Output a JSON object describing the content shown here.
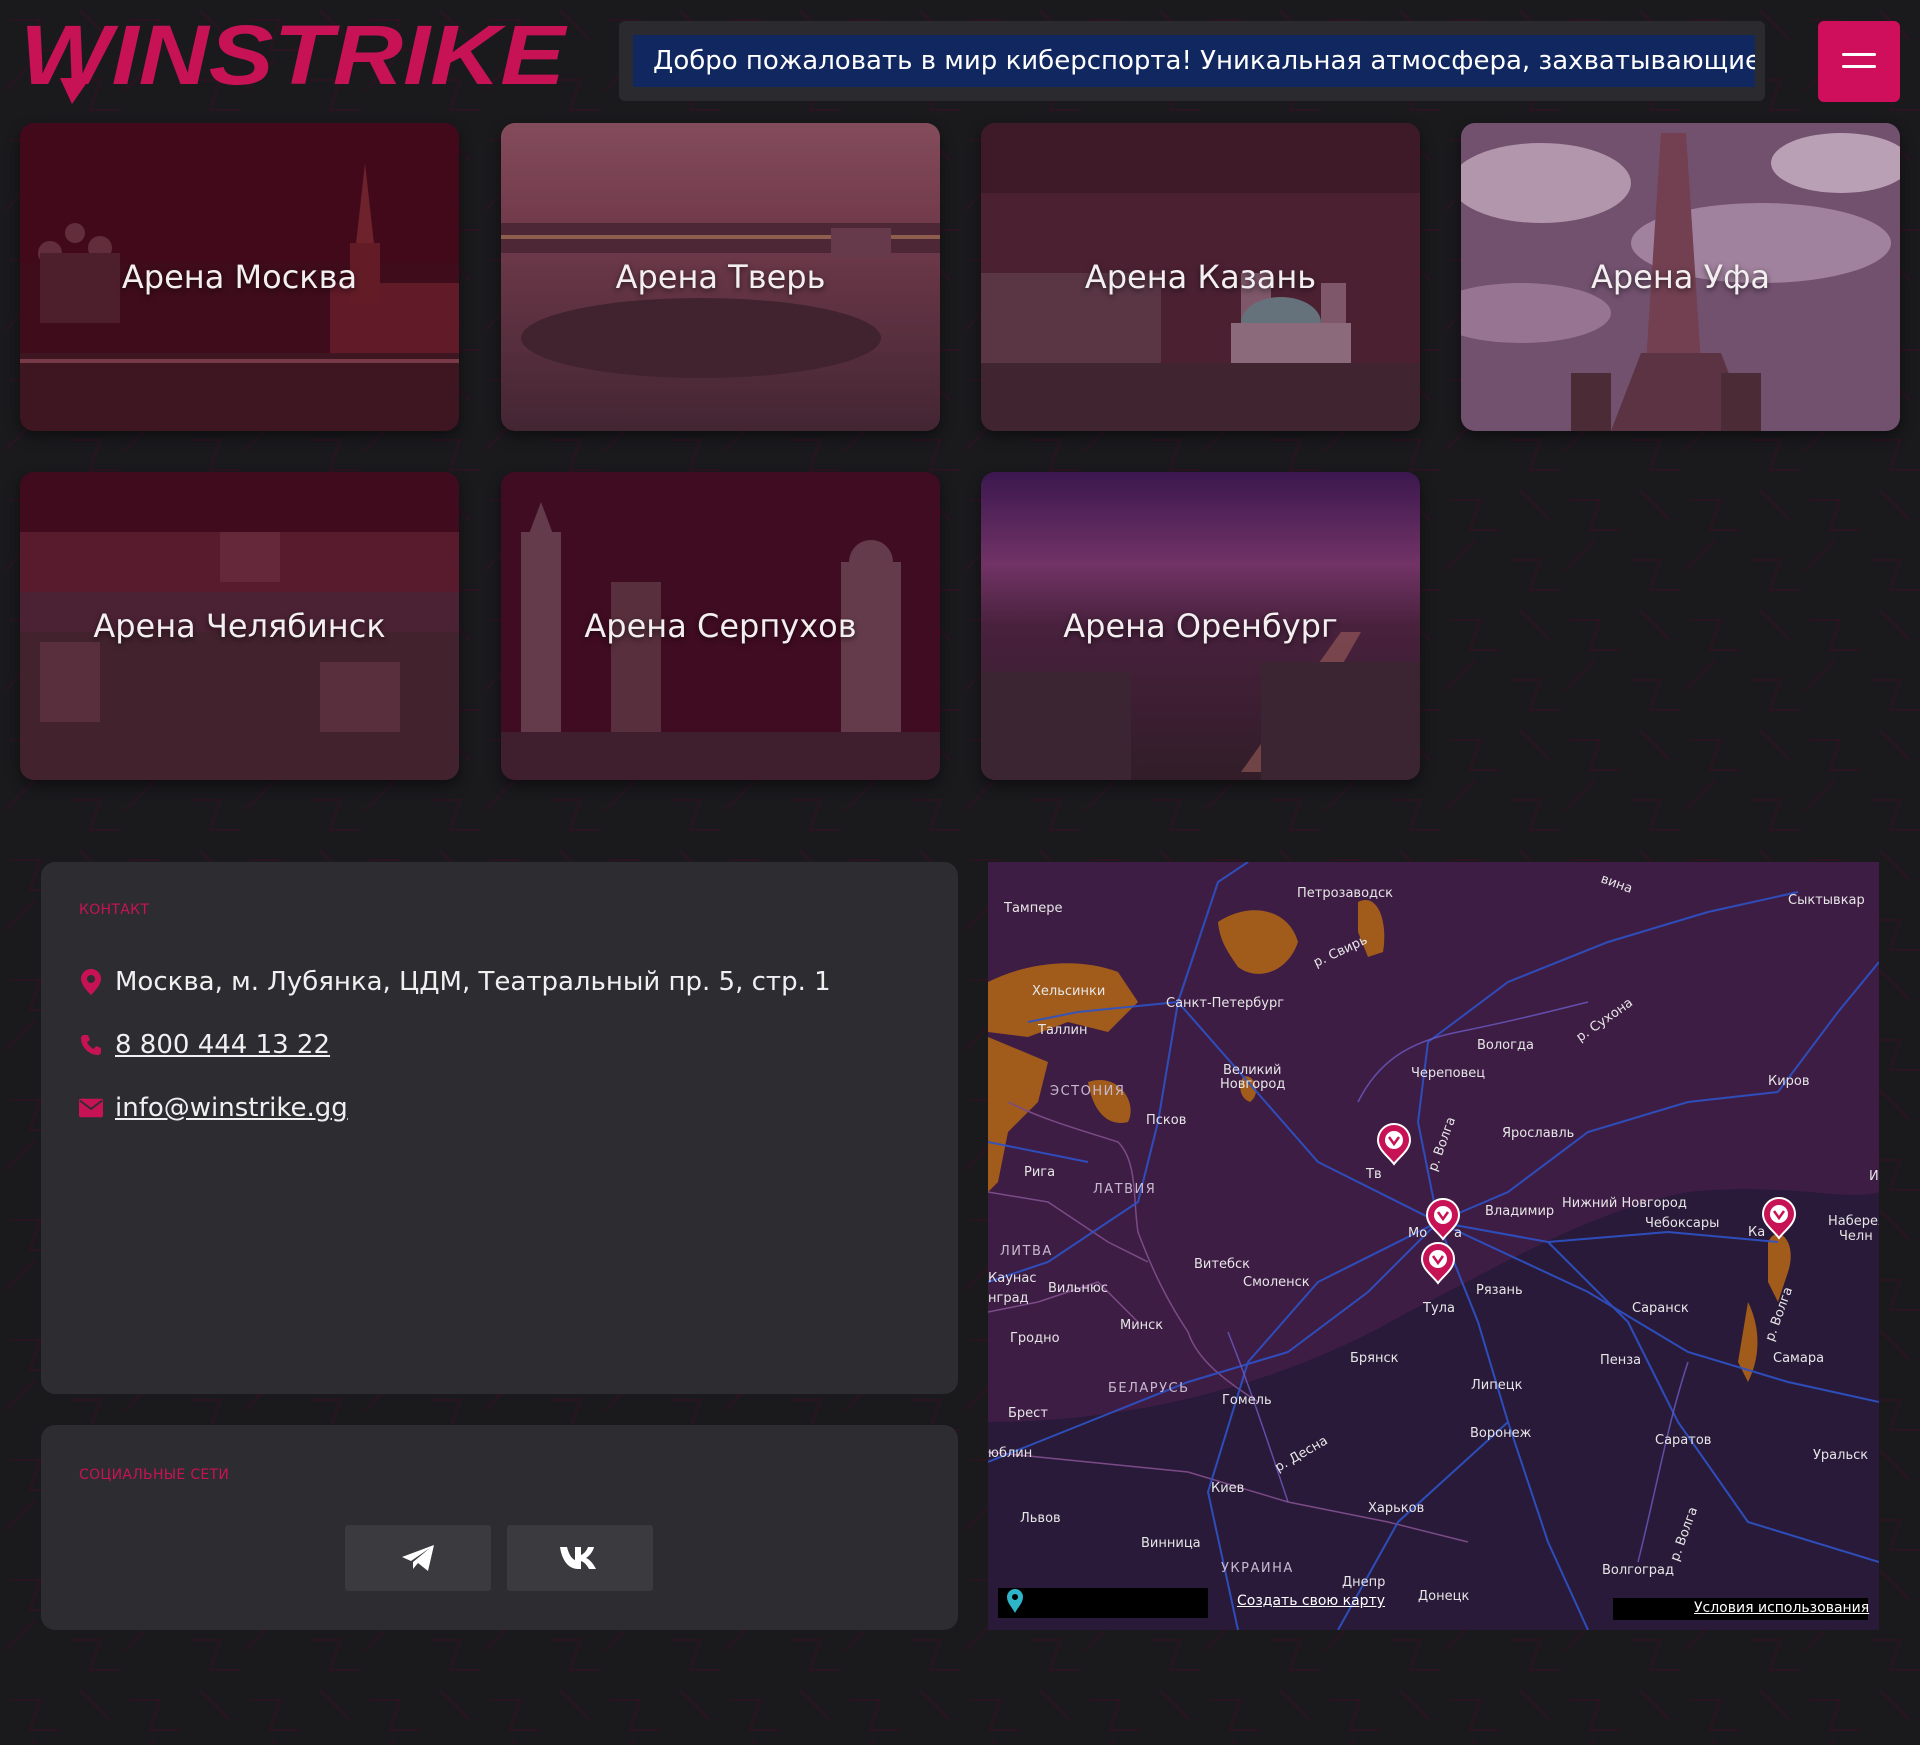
{
  "header": {
    "brand": "WINSTRIKE",
    "ticker": "Добро пожаловать в мир киберспорта! Уникальная атмосфера, захватывающие турниры",
    "menu_icon": "hamburger-menu-icon"
  },
  "arenas": [
    {
      "label": "Арена Москва"
    },
    {
      "label": "Арена Тверь"
    },
    {
      "label": "Арена Казань"
    },
    {
      "label": "Арена Уфа"
    },
    {
      "label": "Арена Челябинск"
    },
    {
      "label": "Арена Серпухов"
    },
    {
      "label": "Арена Оренбург"
    }
  ],
  "contact": {
    "label": "КОНТАКТ",
    "address": "Москва, м. Лубянка, ЦДМ, Театральный пр. 5, стр. 1",
    "phone": "8 800 444 13 22",
    "email": "info@winstrike.gg"
  },
  "social": {
    "label": "СОЦИАЛЬНЫЕ СЕТИ",
    "items": [
      {
        "icon": "telegram-icon"
      },
      {
        "icon": "vk-icon"
      }
    ]
  },
  "map": {
    "create_map_link": "Создать свою карту",
    "terms_link": "Условия использования",
    "cities": {
      "tampere": "Тампере",
      "petrozavodsk": "Петрозаводск",
      "syktyvkar": "Сыктывкар",
      "helsinki": "Хельсинки",
      "spb": "Санкт-Петербург",
      "tallinn": "Таллин",
      "vologda": "Вологда",
      "novgorod1": "Великий",
      "novgorod2": "Новгород",
      "cherepovets": "Череповец",
      "kirov": "Киров",
      "pskov": "Псков",
      "yaroslavl": "Ярославль",
      "riga": "Рига",
      "tver": "Тв",
      "nnovgorod": "Нижний Новгород",
      "vladimir": "Владимир",
      "cheboksary": "Чебоксары",
      "moscow": "Мо",
      "moscow2": "а",
      "kazan": "Ка",
      "naberezh": "Набереж",
      "naberezh2": "Челн",
      "vitebsk": "Витебск",
      "kaunas": "Каунас",
      "vilnius": "Вильнюс",
      "smolensk": "Смоленск",
      "kaliningrad": "нград",
      "ryazan": "Рязань",
      "tula": "Тула",
      "saransk": "Саранск",
      "minsk": "Минск",
      "grodno": "Гродно",
      "bryansk": "Брянск",
      "penza": "Пенза",
      "samara": "Самара",
      "lipetsk": "Липецк",
      "gomel": "Гомель",
      "brest": "Брест",
      "voronezh": "Воронеж",
      "lublin": "юблин",
      "saratov": "Саратов",
      "uralsk": "Уральск",
      "kiev": "Киев",
      "kharkov": "Харьков",
      "lvov": "Львов",
      "vinnitsa": "Винница",
      "volgograd": "Волгоград",
      "dnepr": "Днепр",
      "donetsk": "Донецк",
      "i_edge": "И"
    },
    "regions": {
      "estonia": "ЭСТОНИЯ",
      "latvia": "ЛАТВИЯ",
      "lithuania": "ЛИТВА",
      "belarus": "БЕЛАРУСЬ",
      "ukraine": "УКРАИНА"
    },
    "rivers": {
      "svir": "р. Свирь",
      "sukhona": "р. Сухона",
      "volga1": "р. Волга",
      "volga2": "р. Волга",
      "volga3": "р. Волга",
      "desna": "р. Десна",
      "vuna": "вина"
    }
  },
  "colors": {
    "accent": "#cf0f5c",
    "background": "#1a1a1d",
    "panel": "#2d2d31",
    "ticker_bg": "#102760"
  }
}
